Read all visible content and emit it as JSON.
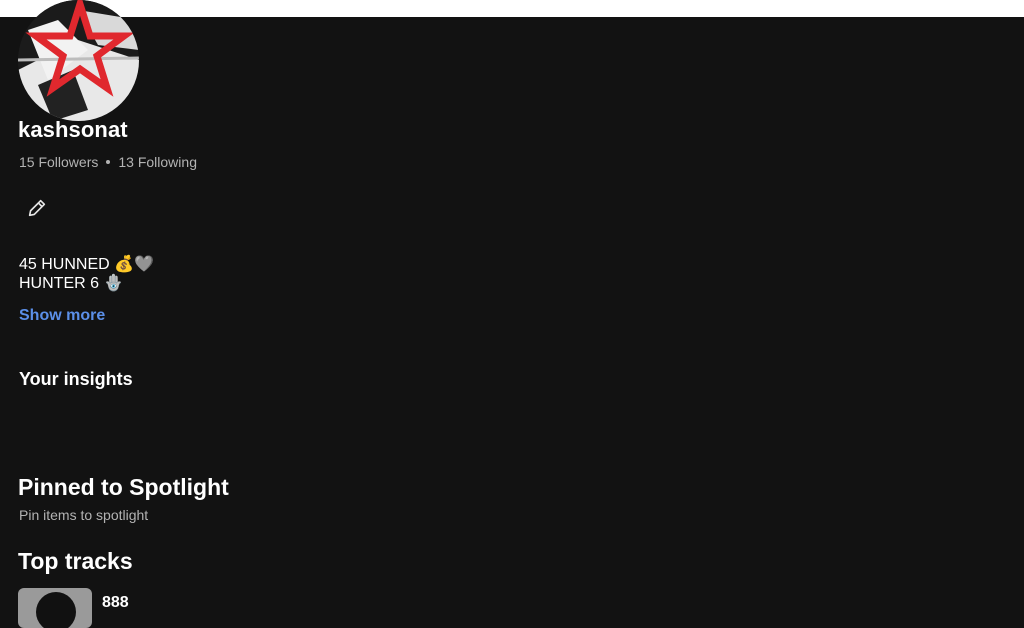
{
  "profile": {
    "username": "kashsonat",
    "followers_label": "15 Followers",
    "following_label": "13 Following"
  },
  "bio": {
    "line1": "45 HUNNED",
    "line1_emojis": "💰🩶",
    "line2": "HUNTER 6",
    "line2_emoji": "🪬",
    "show_more": "Show more"
  },
  "sections": {
    "insights": "Your insights",
    "pinned_title": "Pinned to Spotlight",
    "pinned_subtitle": "Pin items to spotlight",
    "top_tracks": "Top tracks"
  },
  "top_tracks": [
    {
      "title": "888"
    }
  ],
  "colors": {
    "background": "#121212",
    "link": "#5b8fe8",
    "secondary_text": "#b3b3b3",
    "avatar_star": "#e0282e"
  },
  "icons": {
    "edit": "pencil-icon"
  }
}
